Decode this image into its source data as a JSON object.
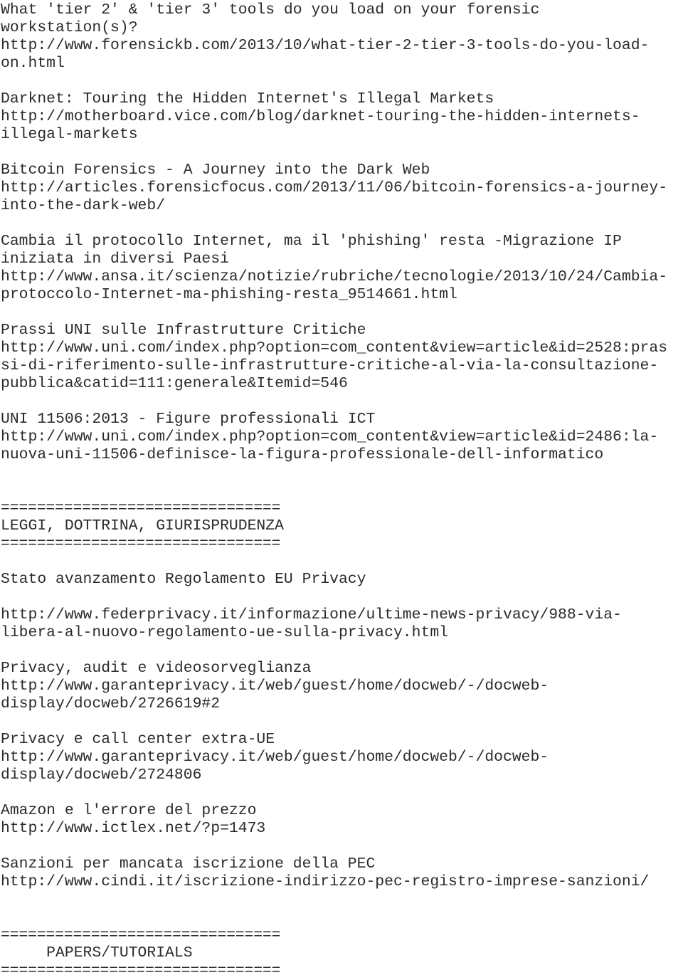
{
  "document": {
    "kind": "plain-text-newsletter-digest",
    "text_color": "#2b2b2b",
    "background_color": "#ffffff",
    "entries": [
      {
        "title": "What 'tier 2' & 'tier 3' tools do you load on your forensic workstation(s)?",
        "url": "http://www.forensickb.com/2013/10/what-tier-2-tier-3-tools-do-you-load-on.html"
      },
      {
        "title": "Darknet: Touring the Hidden Internet's Illegal Markets",
        "url": "http://motherboard.vice.com/blog/darknet-touring-the-hidden-internets-illegal-markets"
      },
      {
        "title": "Bitcoin Forensics - A Journey into the Dark Web",
        "url": "http://articles.forensicfocus.com/2013/11/06/bitcoin-forensics-a-journey-into-the-dark-web/"
      },
      {
        "title": "Cambia il protocollo Internet, ma il 'phishing' resta -Migrazione IP iniziata in diversi Paesi",
        "url": "http://www.ansa.it/scienza/notizie/rubriche/tecnologie/2013/10/24/Cambia-protoccolo-Internet-ma-phishing-resta_9514661.html"
      },
      {
        "title": "Prassi UNI sulle Infrastrutture Critiche",
        "url": "http://www.uni.com/index.php?option=com_content&view=article&id=2528:prassi-di-riferimento-sulle-infrastrutture-critiche-al-via-la-consultazione-pubblica&catid=111:generale&Itemid=546"
      },
      {
        "title": "UNI 11506:2013 - Figure professionali ICT",
        "url": "http://www.uni.com/index.php?option=com_content&view=article&id=2486:la-nuova-uni-11506-definisce-la-figura-professionale-dell-informatico"
      },
      {
        "title": "Stato avanzamento Regolamento EU Privacy",
        "url": "http://www.federprivacy.it/informazione/ultime-news-privacy/988-via-libera-al-nuovo-regolamento-ue-sulla-privacy.html"
      },
      {
        "title": "Privacy, audit e videosorveglianza",
        "url": "http://www.garanteprivacy.it/web/guest/home/docweb/-/docweb-display/docweb/2726619#2"
      },
      {
        "title": "Privacy e call center extra-UE",
        "url": "http://www.garanteprivacy.it/web/guest/home/docweb/-/docweb-display/docweb/2724806"
      },
      {
        "title": "Amazon e l'errore del prezzo",
        "url": "http://www.ictlex.net/?p=1473"
      },
      {
        "title": "Sanzioni per mancata iscrizione della PEC",
        "url": "http://www.cindi.it/iscrizione-indirizzo-pec-registro-imprese-sanzioni/"
      }
    ],
    "section_headings": [
      "LEGGI, DOTTRINA, GIURISPRUDENZA",
      "PAPERS/TUTORIALS"
    ],
    "separator": "===============================",
    "lines": [
      "What 'tier 2' & 'tier 3' tools do you load on your forensic",
      "workstation(s)?",
      "http://www.forensickb.com/2013/10/what-tier-2-tier-3-tools-do-you-load-",
      "on.html",
      "",
      "Darknet: Touring the Hidden Internet's Illegal Markets",
      "http://motherboard.vice.com/blog/darknet-touring-the-hidden-internets-",
      "illegal-markets",
      "",
      "Bitcoin Forensics - A Journey into the Dark Web",
      "http://articles.forensicfocus.com/2013/11/06/bitcoin-forensics-a-journey-",
      "into-the-dark-web/",
      "",
      "Cambia il protocollo Internet, ma il 'phishing' resta -Migrazione IP",
      "iniziata in diversi Paesi",
      "http://www.ansa.it/scienza/notizie/rubriche/tecnologie/2013/10/24/Cambia-",
      "protoccolo-Internet-ma-phishing-resta_9514661.html",
      "",
      "Prassi UNI sulle Infrastrutture Critiche",
      "http://www.uni.com/index.php?option=com_content&view=article&id=2528:pras",
      "si-di-riferimento-sulle-infrastrutture-critiche-al-via-la-consultazione-",
      "pubblica&catid=111:generale&Itemid=546",
      "",
      "UNI 11506:2013 - Figure professionali ICT",
      "http://www.uni.com/index.php?option=com_content&view=article&id=2486:la-",
      "nuova-uni-11506-definisce-la-figura-professionale-dell-informatico",
      "",
      "",
      "===============================",
      "LEGGI, DOTTRINA, GIURISPRUDENZA",
      "===============================",
      "",
      "Stato avanzamento Regolamento EU Privacy",
      "",
      "http://www.federprivacy.it/informazione/ultime-news-privacy/988-via-",
      "libera-al-nuovo-regolamento-ue-sulla-privacy.html",
      "",
      "Privacy, audit e videosorveglianza",
      "http://www.garanteprivacy.it/web/guest/home/docweb/-/docweb-",
      "display/docweb/2726619#2",
      "",
      "Privacy e call center extra-UE",
      "http://www.garanteprivacy.it/web/guest/home/docweb/-/docweb-",
      "display/docweb/2724806",
      "",
      "Amazon e l'errore del prezzo",
      "http://www.ictlex.net/?p=1473",
      "",
      "Sanzioni per mancata iscrizione della PEC",
      "http://www.cindi.it/iscrizione-indirizzo-pec-registro-imprese-sanzioni/",
      "",
      "",
      "===============================",
      "     PAPERS/TUTORIALS",
      "==============================="
    ]
  }
}
